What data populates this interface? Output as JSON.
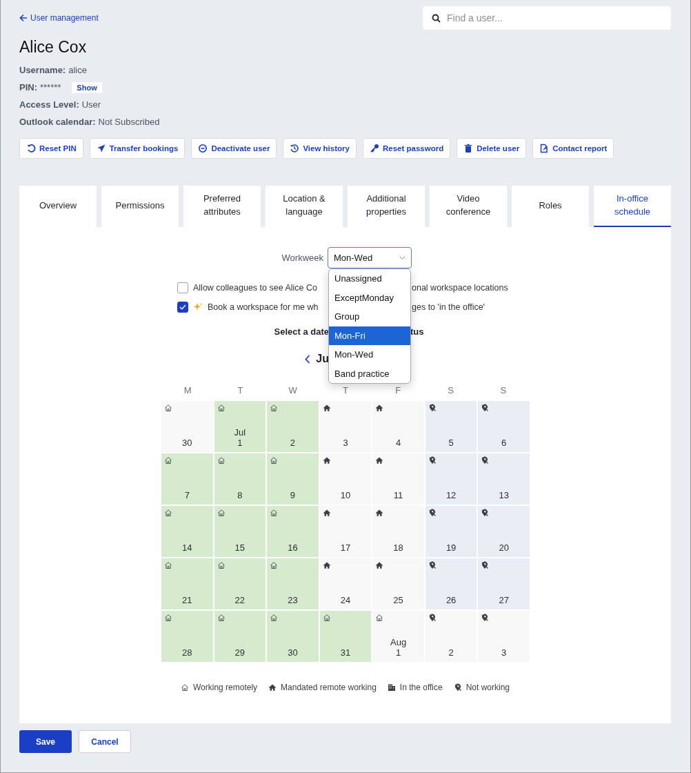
{
  "back_link": "User management",
  "search": {
    "placeholder": "Find a user..."
  },
  "user": {
    "name": "Alice Cox",
    "info": [
      {
        "label": "Username:",
        "value": "alice"
      },
      {
        "label": "PIN:",
        "value": "******",
        "action": "Show"
      },
      {
        "label": "Access Level:",
        "value": "User"
      },
      {
        "label": "Outlook calendar:",
        "value": "Not Subscribed"
      }
    ]
  },
  "actions": [
    {
      "label": "Reset PIN",
      "kind": "reset"
    },
    {
      "label": "Transfer bookings",
      "kind": "send"
    },
    {
      "label": "Deactivate user",
      "kind": "minus"
    },
    {
      "label": "View history",
      "kind": "history"
    },
    {
      "label": "Reset password",
      "kind": "key"
    },
    {
      "label": "Delete user",
      "kind": "trash"
    },
    {
      "label": "Contact report",
      "kind": "report"
    }
  ],
  "tabs": [
    {
      "label": "Overview",
      "selected": false
    },
    {
      "label": "Permissions",
      "selected": false
    },
    {
      "label": "Preferred attributes",
      "selected": false
    },
    {
      "label": "Location & language",
      "selected": false
    },
    {
      "label": "Additional properties",
      "selected": false
    },
    {
      "label": "Video conference",
      "selected": false
    },
    {
      "label": "Roles",
      "selected": false
    },
    {
      "label": "In-office schedule",
      "selected": true
    }
  ],
  "workweek": {
    "label": "Workweek",
    "value": "Mon-Wed",
    "options": [
      {
        "label": "Unassigned",
        "highlighted": false
      },
      {
        "label": "ExceptMonday",
        "highlighted": false
      },
      {
        "label": "Group",
        "highlighted": false
      },
      {
        "label": "Mon-Fri",
        "highlighted": true
      },
      {
        "label": "Mon-Wed",
        "highlighted": false
      },
      {
        "label": "Band practice",
        "highlighted": false
      }
    ]
  },
  "checkboxes": [
    {
      "label_start": "Allow colleagues to see Alice Co",
      "label_end": "onal workspace locations",
      "checked": false,
      "sparkle": false
    },
    {
      "label_start": "Book a workspace for me wh",
      "label_end": "ges to 'in the office'",
      "checked": true,
      "sparkle": true
    }
  ],
  "calendar": {
    "heading_start": "Select a date",
    "heading_end": "tus",
    "month_start": "Ju",
    "weekdays": [
      "M",
      "T",
      "W",
      "T",
      "F",
      "S",
      "S"
    ],
    "weeks": [
      [
        {
          "day": "30",
          "kind": "remote",
          "scheduled": false,
          "weekend": false
        },
        {
          "day": "1",
          "month": "Jul",
          "kind": "remote",
          "scheduled": true,
          "weekend": false
        },
        {
          "day": "2",
          "kind": "remote",
          "scheduled": true,
          "weekend": false
        },
        {
          "day": "3",
          "kind": "mandated",
          "scheduled": false,
          "weekend": false
        },
        {
          "day": "4",
          "kind": "mandated",
          "scheduled": false,
          "weekend": false
        },
        {
          "day": "5",
          "kind": "not_working",
          "scheduled": false,
          "weekend": true
        },
        {
          "day": "6",
          "kind": "not_working",
          "scheduled": false,
          "weekend": true
        }
      ],
      [
        {
          "day": "7",
          "kind": "remote",
          "scheduled": true,
          "weekend": false
        },
        {
          "day": "8",
          "kind": "remote",
          "scheduled": true,
          "weekend": false
        },
        {
          "day": "9",
          "kind": "remote",
          "scheduled": true,
          "weekend": false
        },
        {
          "day": "10",
          "kind": "mandated",
          "scheduled": false,
          "weekend": false
        },
        {
          "day": "11",
          "kind": "mandated",
          "scheduled": false,
          "weekend": false
        },
        {
          "day": "12",
          "kind": "not_working",
          "scheduled": false,
          "weekend": true
        },
        {
          "day": "13",
          "kind": "not_working",
          "scheduled": false,
          "weekend": true
        }
      ],
      [
        {
          "day": "14",
          "kind": "remote",
          "scheduled": true,
          "weekend": false
        },
        {
          "day": "15",
          "kind": "remote",
          "scheduled": true,
          "weekend": false
        },
        {
          "day": "16",
          "kind": "remote",
          "scheduled": true,
          "weekend": false
        },
        {
          "day": "17",
          "kind": "mandated",
          "scheduled": false,
          "weekend": false
        },
        {
          "day": "18",
          "kind": "mandated",
          "scheduled": false,
          "weekend": false
        },
        {
          "day": "19",
          "kind": "not_working",
          "scheduled": false,
          "weekend": true
        },
        {
          "day": "20",
          "kind": "not_working",
          "scheduled": false,
          "weekend": true
        }
      ],
      [
        {
          "day": "21",
          "kind": "remote",
          "scheduled": true,
          "weekend": false
        },
        {
          "day": "22",
          "kind": "remote",
          "scheduled": true,
          "weekend": false
        },
        {
          "day": "23",
          "kind": "remote",
          "scheduled": true,
          "weekend": false
        },
        {
          "day": "24",
          "kind": "mandated",
          "scheduled": false,
          "weekend": false
        },
        {
          "day": "25",
          "kind": "mandated",
          "scheduled": false,
          "weekend": false
        },
        {
          "day": "26",
          "kind": "not_working",
          "scheduled": false,
          "weekend": true
        },
        {
          "day": "27",
          "kind": "not_working",
          "scheduled": false,
          "weekend": true
        }
      ],
      [
        {
          "day": "28",
          "kind": "remote",
          "scheduled": true,
          "weekend": false
        },
        {
          "day": "29",
          "kind": "remote",
          "scheduled": true,
          "weekend": false
        },
        {
          "day": "30",
          "kind": "remote",
          "scheduled": true,
          "weekend": false
        },
        {
          "day": "31",
          "kind": "remote",
          "scheduled": true,
          "weekend": false
        },
        {
          "day": "1",
          "month": "Aug",
          "kind": "remote",
          "scheduled": false,
          "weekend": false
        },
        {
          "day": "2",
          "kind": "not_working",
          "scheduled": false,
          "weekend": false
        },
        {
          "day": "3",
          "kind": "not_working",
          "scheduled": false,
          "weekend": false
        }
      ]
    ]
  },
  "legend": [
    {
      "kind": "remote",
      "label": "Working remotely"
    },
    {
      "kind": "mandated",
      "label": "Mandated remote working"
    },
    {
      "kind": "office",
      "label": "In the office"
    },
    {
      "kind": "not_working",
      "label": "Not working"
    }
  ],
  "buttons": [
    {
      "label": "Save",
      "kind": "primary"
    },
    {
      "label": "Cancel",
      "kind": "secondary"
    }
  ]
}
